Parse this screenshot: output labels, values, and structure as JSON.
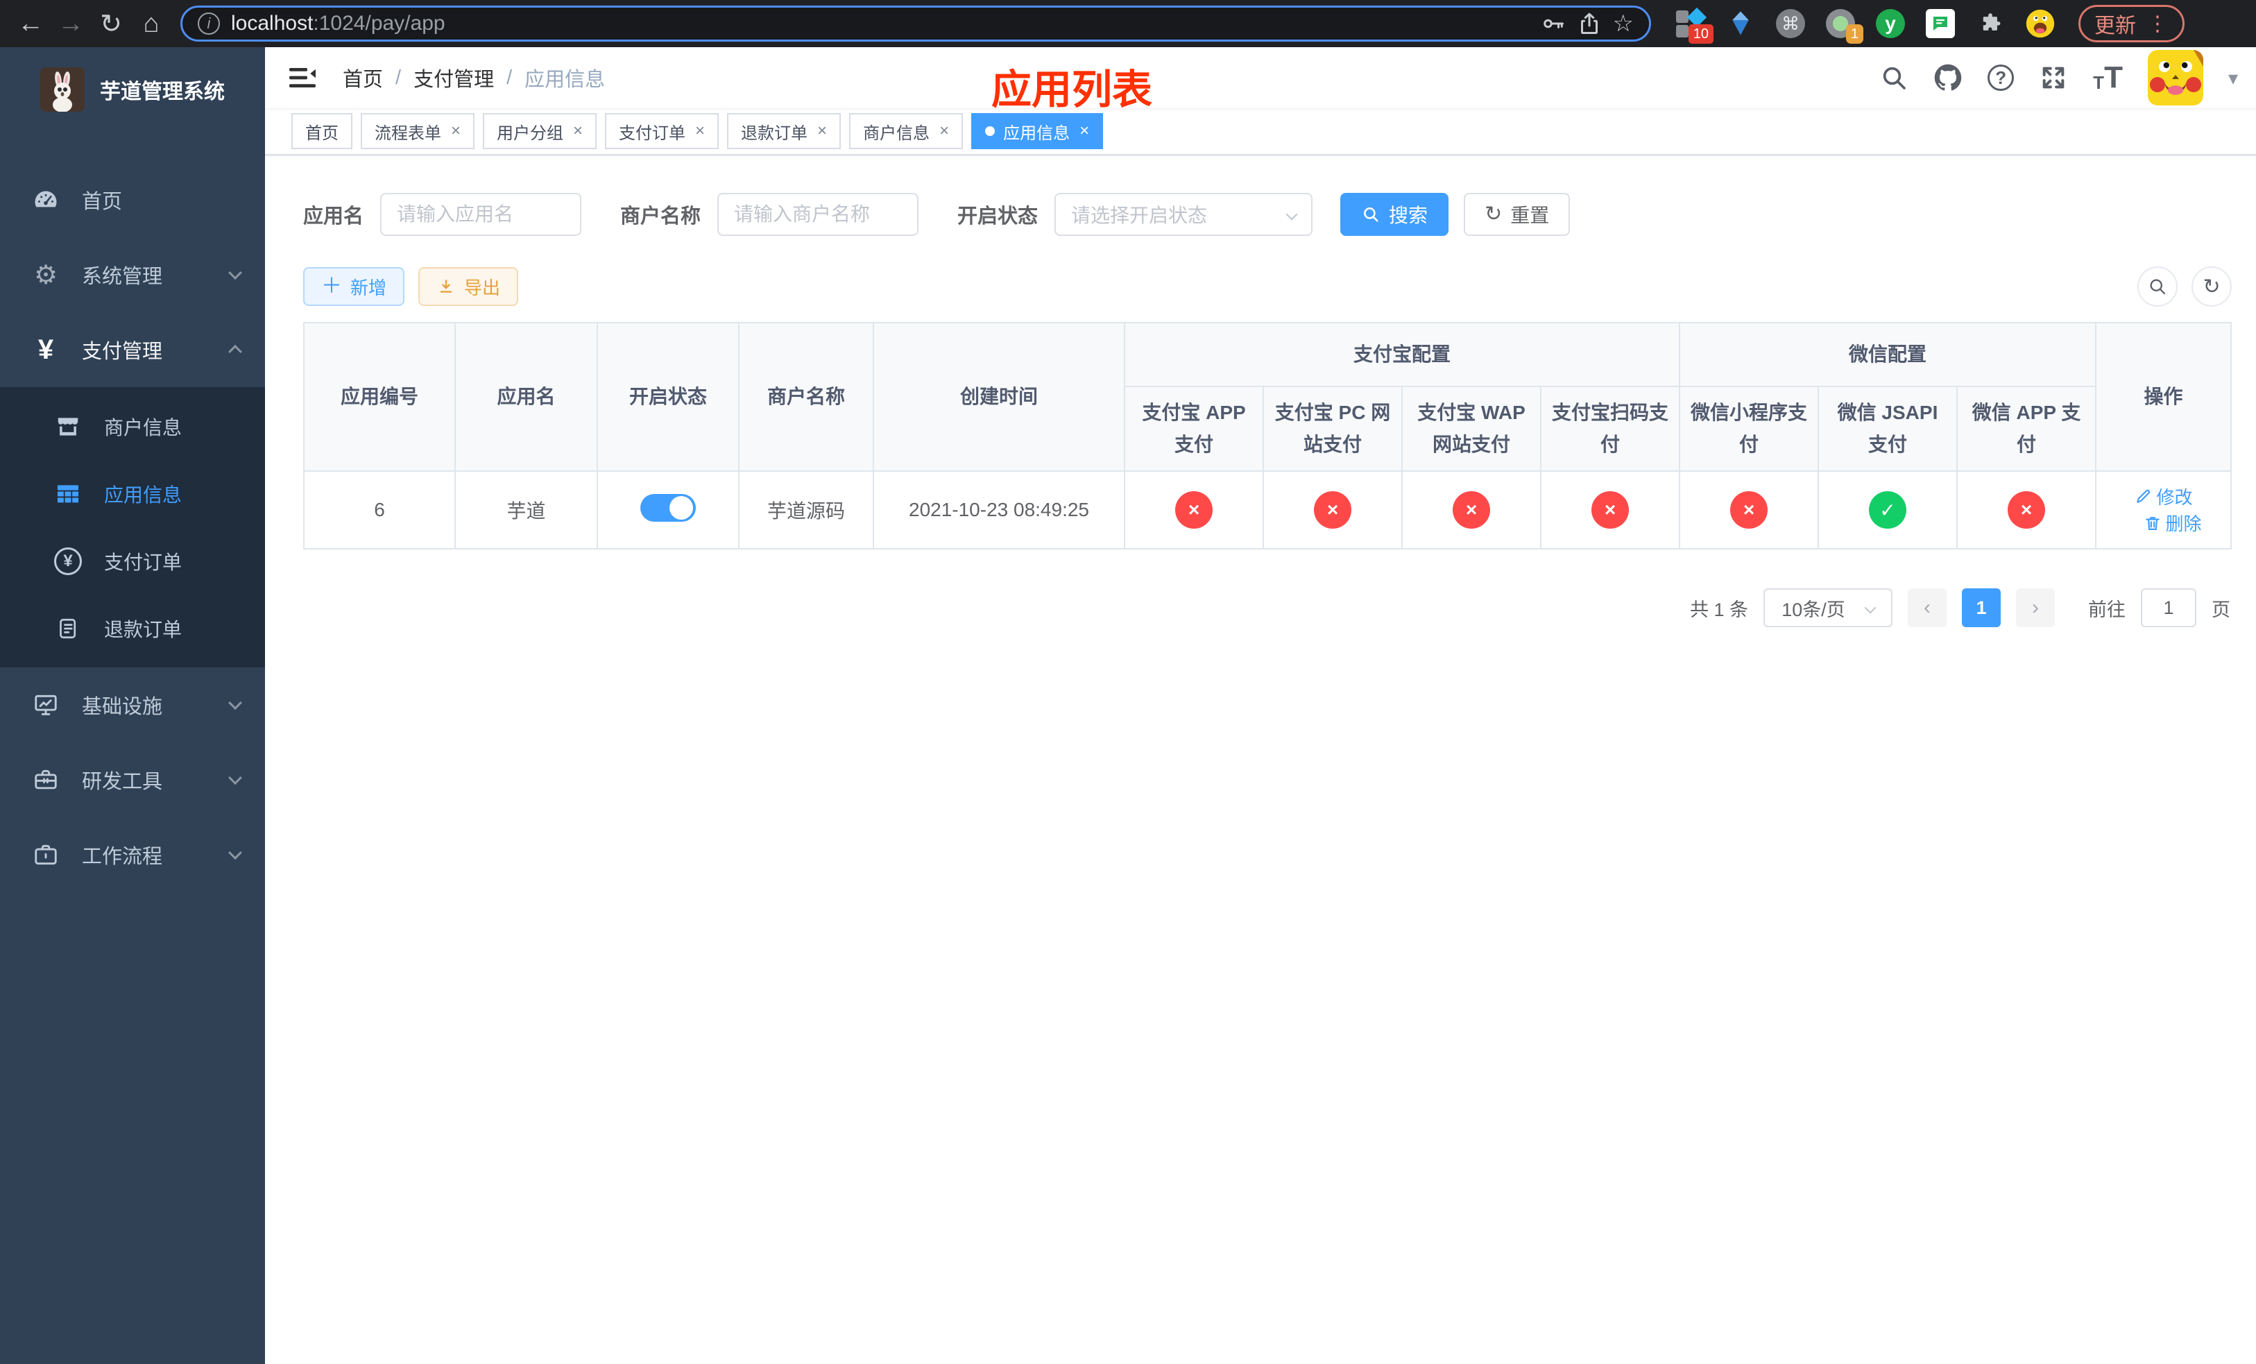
{
  "browser": {
    "url": {
      "host": "localhost",
      "rest": ":1024/pay/app"
    },
    "update_label": "更新",
    "extensions": {
      "badge_a": "10",
      "badge_b": "1",
      "letter_ext": "y"
    }
  },
  "icons": {
    "back": "←",
    "forward": "→",
    "reload": "↻",
    "home": "⌂",
    "star": "☆",
    "kebab": "⋮",
    "command": "⌘",
    "yen": "¥",
    "help": "?",
    "close": "×",
    "check": "✓",
    "cross": "×",
    "prev": "‹",
    "next": "›",
    "plus": "＋",
    "reset": "↻",
    "caret": "▾",
    "info": "i",
    "t_small": "T",
    "t_large": "T"
  },
  "sidebar": {
    "app_title": "芋道管理系统",
    "items": [
      {
        "label": "首页"
      },
      {
        "label": "系统管理"
      },
      {
        "label": "支付管理"
      },
      {
        "label": "商户信息"
      },
      {
        "label": "应用信息"
      },
      {
        "label": "支付订单"
      },
      {
        "label": "退款订单"
      },
      {
        "label": "基础设施"
      },
      {
        "label": "研发工具"
      },
      {
        "label": "工作流程"
      }
    ]
  },
  "navbar": {
    "breadcrumb": {
      "home": "首页",
      "section": "支付管理",
      "current": "应用信息",
      "separator": "/"
    },
    "page_title": "应用列表"
  },
  "tabs": [
    {
      "label": "首页"
    },
    {
      "label": "流程表单"
    },
    {
      "label": "用户分组"
    },
    {
      "label": "支付订单"
    },
    {
      "label": "退款订单"
    },
    {
      "label": "商户信息"
    },
    {
      "label": "应用信息"
    }
  ],
  "filters": {
    "app_name_label": "应用名",
    "app_name_placeholder": "请输入应用名",
    "merchant_label": "商户名称",
    "merchant_placeholder": "请输入商户名称",
    "status_label": "开启状态",
    "status_placeholder": "请选择开启状态",
    "search_label": "搜索",
    "reset_label": "重置"
  },
  "toolbar": {
    "add_label": "新增",
    "export_label": "导出"
  },
  "table": {
    "headers": {
      "app_id": "应用编号",
      "app_name": "应用名",
      "status": "开启状态",
      "merchant": "商户名称",
      "create_time": "创建时间",
      "alipay_group": "支付宝配置",
      "wechat_group": "微信配置",
      "alipay_app": "支付宝 APP 支付",
      "alipay_pc": "支付宝 PC 网站支付",
      "alipay_wap": "支付宝 WAP 网站支付",
      "alipay_qr": "支付宝扫码支付",
      "wechat_lite": "微信小程序支付",
      "wechat_jsapi": "微信 JSAPI 支付",
      "wechat_app": "微信 APP 支付",
      "actions": "操作"
    },
    "row_actions": {
      "edit": "修改",
      "delete": "删除"
    },
    "rows": [
      {
        "app_id": "6",
        "app_name": "芋道",
        "enabled": true,
        "merchant": "芋道源码",
        "create_time": "2021-10-23 08:49:25",
        "alipay_app": false,
        "alipay_pc": false,
        "alipay_wap": false,
        "alipay_qr": false,
        "wechat_lite": false,
        "wechat_jsapi": true,
        "wechat_app": false
      }
    ]
  },
  "pagination": {
    "total_label": "共 1 条",
    "page_size": "10条/页",
    "current_page": "1",
    "goto_label": "前往",
    "goto_value": "1",
    "page_unit": "页"
  },
  "colors": {
    "accent": "#409EFF",
    "success": "#13ce66",
    "danger": "#ff4949",
    "warning": "#e6a23c",
    "title_red": "#ff3000",
    "sidebar_bg": "#304156",
    "submenu_bg": "#1f2d3d"
  }
}
